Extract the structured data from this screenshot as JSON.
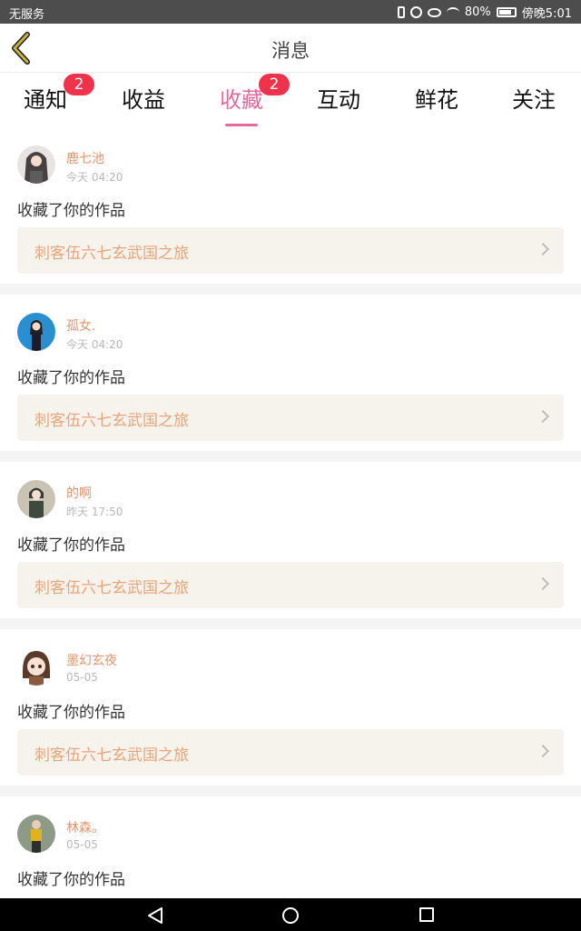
{
  "status_bar": {
    "carrier": "无服务",
    "battery": "80%",
    "time": "傍晚5:01",
    "icons": [
      "vibrate-icon",
      "alarm-icon",
      "eye-icon",
      "wifi-icon",
      "sim-icon",
      "battery-icon"
    ]
  },
  "header": {
    "title": "消息",
    "back_icon": "chevron-left-icon",
    "accent_color": "#b8a23c"
  },
  "tabs": [
    {
      "label": "通知",
      "badge": "2",
      "active": false
    },
    {
      "label": "收益",
      "badge": null,
      "active": false
    },
    {
      "label": "收藏",
      "badge": "2",
      "active": true
    },
    {
      "label": "互动",
      "badge": null,
      "active": false
    },
    {
      "label": "鲜花",
      "badge": null,
      "active": false
    },
    {
      "label": "关注",
      "badge": null,
      "active": false
    }
  ],
  "colors": {
    "active_tab": "#e56a9b",
    "badge": "#f0334b",
    "username": "#e9956b",
    "work_title": "#eda37a",
    "work_bg": "#f6f3ec"
  },
  "notifications": [
    {
      "username": "鹿七池",
      "time": "今天 04:20",
      "action": "收藏了你的作品",
      "work": "刺客伍六七玄武国之旅"
    },
    {
      "username": "孤女.",
      "time": "今天 04:20",
      "action": "收藏了你的作品",
      "work": "刺客伍六七玄武国之旅"
    },
    {
      "username": "的啊",
      "time": "昨天 17:50",
      "action": "收藏了你的作品",
      "work": "刺客伍六七玄武国之旅"
    },
    {
      "username": "墨幻玄夜",
      "time": "05-05",
      "action": "收藏了你的作品",
      "work": "刺客伍六七玄武国之旅"
    },
    {
      "username": "林森。",
      "time": "05-05",
      "action": "收藏了你的作品",
      "work": "刺客伍六七玄武国之旅"
    }
  ],
  "nav_bar": {
    "icons": [
      "nav-back-icon",
      "nav-home-icon",
      "nav-recents-icon"
    ]
  }
}
